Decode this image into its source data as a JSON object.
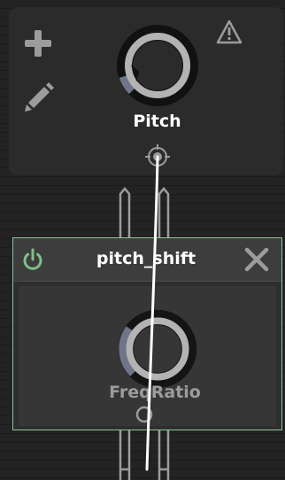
{
  "top_panel": {
    "knob_label": "Pitch",
    "knob_level": 0.1,
    "icons": [
      "plus-icon",
      "pencil-icon",
      "warning-icon"
    ]
  },
  "module": {
    "title": "pitch_shift",
    "knob_label": "FreqRatio",
    "knob_level": 0.3,
    "power_on": true,
    "icons": [
      "power-icon",
      "close-icon"
    ]
  },
  "colors": {
    "background": "#232323",
    "panel": "#2b2b2b",
    "module_border": "#8fc49a",
    "power_green": "#7fbf8a",
    "knob_ring": "#b3b3b3",
    "knob_arc": "#6f7689",
    "wire": "#ffffff"
  }
}
